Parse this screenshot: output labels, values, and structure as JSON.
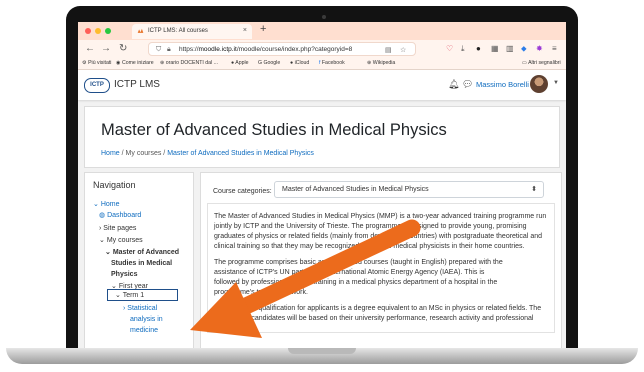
{
  "browser": {
    "tab_title": "ICTP LMS: All courses",
    "new_tab": "+",
    "tab_close": "×",
    "url_prefix": "https://",
    "url_host": "moodle.ictp.it",
    "url_path": "/moodle/course/index.php?categoryid=8",
    "bookmarks": [
      "Più visitati",
      "Come iniziare",
      "orario DOCENTI dal ...",
      "Apple",
      "Google",
      "iCloud",
      "Facebook",
      "Wikipedia"
    ],
    "bookmarks_other": "Altri segnalibri"
  },
  "site": {
    "logo_text": "ICTP",
    "brand": "ICTP LMS",
    "user_name": "Massimo Borelli"
  },
  "page": {
    "title": "Master of Advanced Studies in Medical Physics",
    "breadcrumb": {
      "home": "Home",
      "sep": "/",
      "courses": "My courses",
      "current": "Master of Advanced Studies in Medical Physics"
    }
  },
  "navigation": {
    "title": "Navigation",
    "home": "Home",
    "dashboard": "Dashboard",
    "site_pages": "Site pages",
    "my_courses": "My courses",
    "program_line1": "Master of Advanced",
    "program_line2": "Studies in Medical",
    "program_line3": "Physics",
    "first_year": "First year",
    "term": "Term 1",
    "course_line1": "Statistical",
    "course_line2": "analysis in",
    "course_line3": "medicine"
  },
  "content": {
    "category_label": "Course categories:",
    "category_value": "Master of Advanced Studies in Medical Physics",
    "description": [
      "The Master of Advanced Studies in Medical Physics (MMP) is a two-year advanced training programme run",
      "jointly by ICTP and the University of Trieste. The programme is designed to provide young, promising",
      "graduates of physics or related fields (mainly from developing countries) with postgraduate theoretical and",
      "clinical training so that they may be recognized as clinical medical physicists in their home countries.",
      "The programme comprises basic and advanced courses (taught in English) prepared with the",
      "assistance of ICTP's UN partner the International Atomic Energy Agency (IAEA). This is",
      "followed by professional clinical training in a medical physics department of a hospital in the",
      "programme's training network.",
      "The minimum qualification for applicants is a degree equivalent to an MSc in physics or related fields. The",
      "selection of candidates will be based on their university performance, research activity and professional"
    ]
  },
  "colors": {
    "accent": "#0f6cbf",
    "arrow": "#ec6b1c",
    "tabbar": "#ffdfd0"
  }
}
